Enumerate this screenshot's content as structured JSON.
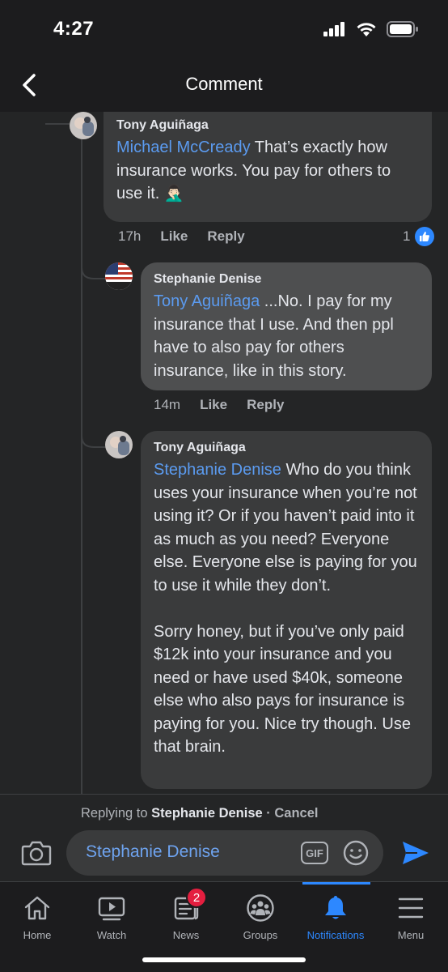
{
  "status": {
    "time": "4:27"
  },
  "header": {
    "title": "Comment"
  },
  "comments": [
    {
      "author": "Tony Aguiñaga",
      "mention": "Michael McCready",
      "text": " That’s exactly how insurance works. You pay for others to use it. 🤦🏻‍♂️",
      "time": "17h",
      "like_label": "Like",
      "reply_label": "Reply",
      "likes": "1"
    },
    {
      "author": "Stephanie Denise",
      "mention": "Tony Aguiñaga",
      "text": " ...No. I pay for my insurance that I use. And then ppl have to also pay for others insurance, like in this story.",
      "time": "14m",
      "like_label": "Like",
      "reply_label": "Reply"
    },
    {
      "author": "Tony Aguiñaga",
      "mention": "Stephanie Denise",
      "text": " Who do you think uses your insurance when you’re not using it? Or if you haven’t paid into it as much as you need? Everyone else. Everyone else is paying for you to use it while they don’t.\n\nSorry honey, but if you’ve only paid $12k into your insurance and you need or have used $40k, someone else who also pays for insurance is paying for you. Nice try though. Use that brain."
    }
  ],
  "reply_bar": {
    "prefix": "Replying to ",
    "name": "Stephanie Denise",
    "cancel": " · Cancel",
    "input_value": "Stephanie Denise",
    "gif_label": "GIF"
  },
  "tabs": [
    {
      "label": "Home",
      "icon": "home-icon"
    },
    {
      "label": "Watch",
      "icon": "watch-icon"
    },
    {
      "label": "News",
      "icon": "news-icon",
      "badge": "2"
    },
    {
      "label": "Groups",
      "icon": "groups-icon"
    },
    {
      "label": "Notifications",
      "icon": "bell-icon",
      "active": true
    },
    {
      "label": "Menu",
      "icon": "menu-icon"
    }
  ],
  "colors": {
    "accent": "#2d88ff",
    "mention": "#5b9bf0",
    "badge": "#e41e3f"
  }
}
